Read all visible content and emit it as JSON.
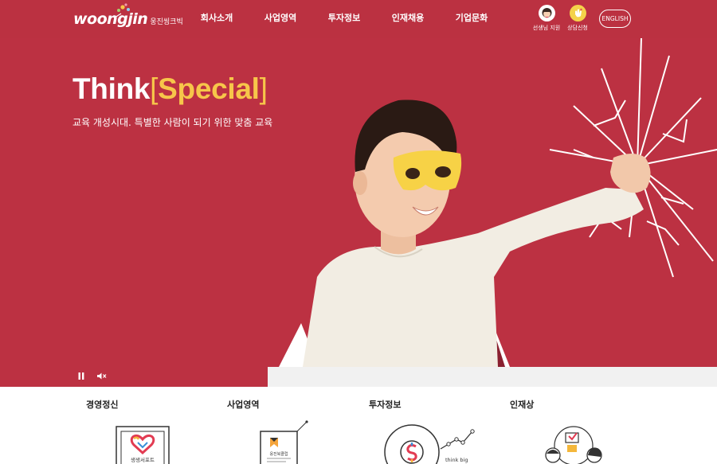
{
  "header": {
    "logo_text": "woongjin",
    "logo_korean": "웅진씽크빅",
    "nav": [
      "회사소개",
      "사업영역",
      "투자정보",
      "인재채용",
      "기업문화"
    ],
    "util_teacher_label": "선생님 지원",
    "util_consult_label": "상담신청",
    "english_label": "ENGLISH"
  },
  "hero": {
    "title_think": "Think",
    "title_open": "[",
    "title_special": "Special",
    "title_close": "]",
    "subtitle": "교육 개성시대. 특별한 사람이 되기 위한 맞춤 교육",
    "controls": [
      "pause-icon",
      "mute-icon"
    ]
  },
  "sections": [
    {
      "title": "경영정신",
      "icon": "heart-frame-icon",
      "badge_text": "생생서포트"
    },
    {
      "title": "사업영역",
      "icon": "book-document-icon",
      "badge_text": "웅진북클럽"
    },
    {
      "title": "투자정보",
      "icon": "chart-circle-icon",
      "badge_text": "think big"
    },
    {
      "title": "인재상",
      "icon": "people-idea-icon"
    }
  ],
  "colors": {
    "brand_red": "#bc3142",
    "accent_yellow": "#f7c64a",
    "text_dark": "#222222"
  }
}
